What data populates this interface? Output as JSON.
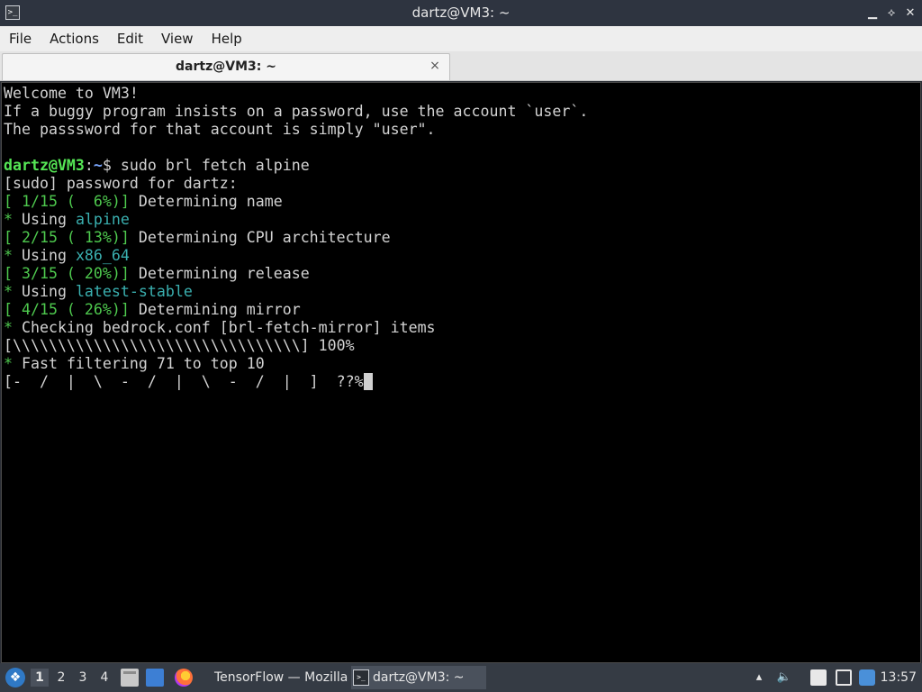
{
  "window": {
    "title": "dartz@VM3: ~",
    "minimize_glyph": "▁",
    "maximize_glyph": "⟡",
    "close_glyph": "✕"
  },
  "menubar": {
    "items": [
      "File",
      "Actions",
      "Edit",
      "View",
      "Help"
    ]
  },
  "tab": {
    "label": "dartz@VM3: ~",
    "close_glyph": "×"
  },
  "terminal": {
    "colors": {
      "background": "#000000",
      "text": "#d3d3d3",
      "green": "#4ec94e",
      "prompt_user": "#55e655",
      "prompt_path": "#7aa7ff",
      "cyan": "#3ab0b0"
    },
    "lines": [
      [
        {
          "t": "Welcome to VM3!"
        }
      ],
      [
        {
          "t": "If a buggy program insists on a password, use the account `user`."
        }
      ],
      [
        {
          "t": "The passsword for that account is simply \"user\"."
        }
      ],
      [
        {
          "t": ""
        }
      ],
      [
        {
          "t": "dartz@VM3",
          "c": "bgreen"
        },
        {
          "t": ":"
        },
        {
          "t": "~",
          "c": "blue"
        },
        {
          "t": "$ sudo brl fetch alpine"
        }
      ],
      [
        {
          "t": "[sudo] password for dartz:"
        }
      ],
      [
        {
          "t": "[ 1/15 (  6%)]",
          "c": "green"
        },
        {
          "t": " Determining name"
        }
      ],
      [
        {
          "t": "*",
          "c": "green"
        },
        {
          "t": " Using "
        },
        {
          "t": "alpine",
          "c": "cyan"
        }
      ],
      [
        {
          "t": "[ 2/15 ( 13%)]",
          "c": "green"
        },
        {
          "t": " Determining CPU architecture"
        }
      ],
      [
        {
          "t": "*",
          "c": "green"
        },
        {
          "t": " Using "
        },
        {
          "t": "x86_64",
          "c": "cyan"
        }
      ],
      [
        {
          "t": "[ 3/15 ( 20%)]",
          "c": "green"
        },
        {
          "t": " Determining release"
        }
      ],
      [
        {
          "t": "*",
          "c": "green"
        },
        {
          "t": " Using "
        },
        {
          "t": "latest-stable",
          "c": "cyan"
        }
      ],
      [
        {
          "t": "[ 4/15 ( 26%)]",
          "c": "green"
        },
        {
          "t": " Determining mirror"
        }
      ],
      [
        {
          "t": "*",
          "c": "green"
        },
        {
          "t": " Checking bedrock.conf [brl-fetch-mirror] items"
        }
      ],
      [
        {
          "t": "[\\\\\\\\\\\\\\\\\\\\\\\\\\\\\\\\\\\\\\\\\\\\\\\\\\\\\\\\\\\\\\\\] 100%"
        }
      ],
      [
        {
          "t": "*",
          "c": "green"
        },
        {
          "t": " Fast filtering 71 to top 10"
        }
      ],
      [
        {
          "t": "[-  /  |  \\  -  /  |  \\  -  /  |  ]  ??%"
        },
        {
          "cursor": true
        }
      ]
    ]
  },
  "taskbar": {
    "start_icon": "bedrock-menu-icon",
    "workspaces": [
      "1",
      "2",
      "3",
      "4"
    ],
    "active_workspace": "1",
    "tasks": [
      {
        "label": "TensorFlow — Mozilla...",
        "icon": "firefox-icon",
        "active": false
      },
      {
        "label": "dartz@VM3: ~",
        "icon": "terminal-icon",
        "active": true
      }
    ],
    "volume_glyph": "🔈",
    "clock": "13:57"
  }
}
